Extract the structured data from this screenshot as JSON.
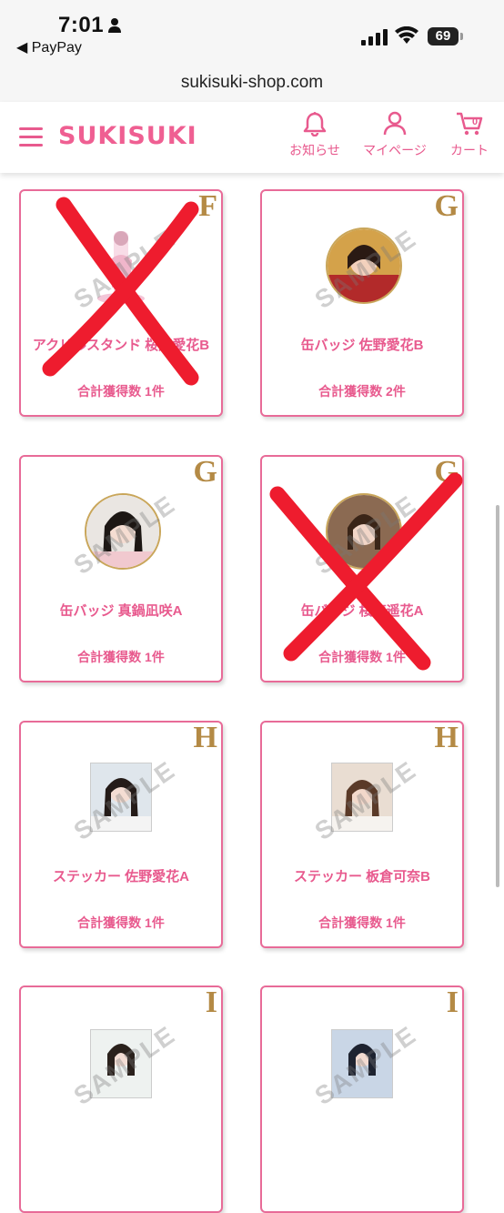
{
  "status_bar": {
    "time": "7:01",
    "back_app": "◀ PayPay",
    "battery": "69"
  },
  "browser": {
    "url": "sukisuki-shop.com"
  },
  "header": {
    "logo": "SUKISUKI",
    "nav": {
      "news": "お知らせ",
      "mypage": "マイページ",
      "cart": "カート",
      "cart_count": "0"
    }
  },
  "products": [
    {
      "grade": "F",
      "name": "アクリルスタンド 桜庭愛花B",
      "count": "合計獲得数 1件",
      "crossed": true
    },
    {
      "grade": "G",
      "name": "缶バッジ 佐野愛花B",
      "count": "合計獲得数 2件",
      "crossed": false
    },
    {
      "grade": "G",
      "name": "缶バッジ 真鍋凪咲A",
      "count": "合計獲得数 1件",
      "crossed": false
    },
    {
      "grade": "G",
      "name": "缶バッジ 桜庭遥花A",
      "count": "合計獲得数 1件",
      "crossed": true
    },
    {
      "grade": "H",
      "name": "ステッカー 佐野愛花A",
      "count": "合計獲得数 1件",
      "crossed": false
    },
    {
      "grade": "H",
      "name": "ステッカー 板倉可奈B",
      "count": "合計獲得数 1件",
      "crossed": false
    },
    {
      "grade": "I",
      "name": "",
      "count": "",
      "crossed": false
    },
    {
      "grade": "I",
      "name": "",
      "count": "",
      "crossed": false
    }
  ],
  "watermark": "SAMPLE",
  "colors": {
    "accent": "#e85a8e",
    "grade_gold": "#b48a45",
    "cross_red": "#ee1c2e"
  }
}
